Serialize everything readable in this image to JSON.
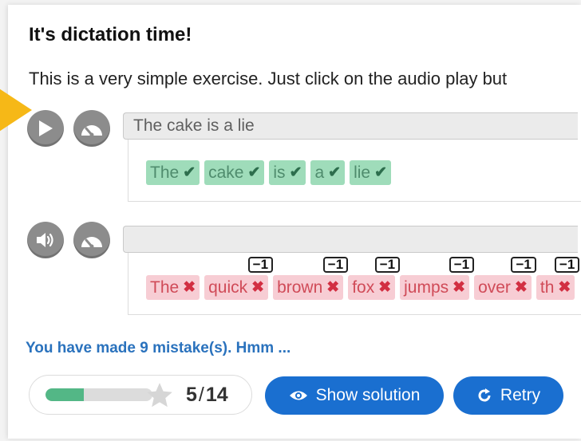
{
  "title": "It's dictation time!",
  "intro": "This is a very simple exercise. Just click on the audio play but",
  "dictations": [
    {
      "play_icon": "play-icon",
      "speed_icon": "gauge-icon",
      "answer": "The cake is a lie",
      "words": [
        {
          "text": "The",
          "status": "correct"
        },
        {
          "text": "cake",
          "status": "correct"
        },
        {
          "text": "is",
          "status": "correct"
        },
        {
          "text": "a",
          "status": "correct"
        },
        {
          "text": "lie",
          "status": "correct"
        }
      ]
    },
    {
      "play_icon": "speaker-icon",
      "speed_icon": "gauge-icon",
      "answer": "",
      "words": [
        {
          "text": "The",
          "status": "wrong",
          "penalty": ""
        },
        {
          "text": "quick",
          "status": "wrong",
          "penalty": "−1"
        },
        {
          "text": "brown",
          "status": "wrong",
          "penalty": "−1"
        },
        {
          "text": "fox",
          "status": "wrong",
          "penalty": "−1"
        },
        {
          "text": "jumps",
          "status": "wrong",
          "penalty": "−1"
        },
        {
          "text": "over",
          "status": "wrong",
          "penalty": "−1"
        },
        {
          "text": "th",
          "status": "wrong",
          "penalty": "−1"
        }
      ]
    }
  ],
  "marks": {
    "correct": "✔",
    "wrong": "✖"
  },
  "message": "You have made 9 mistake(s). Hmm ...",
  "score": {
    "current": "5",
    "separator": "/",
    "max": "14",
    "progress": 0.36
  },
  "buttons": {
    "show_solution": "Show solution",
    "retry": "Retry"
  },
  "colors": {
    "accent_blue": "#1a6fd0",
    "correct_bg": "#9fdcba",
    "wrong_bg": "#f7cdd4",
    "progress_fill": "#53b786",
    "pointer_arrow": "#f6b817"
  }
}
